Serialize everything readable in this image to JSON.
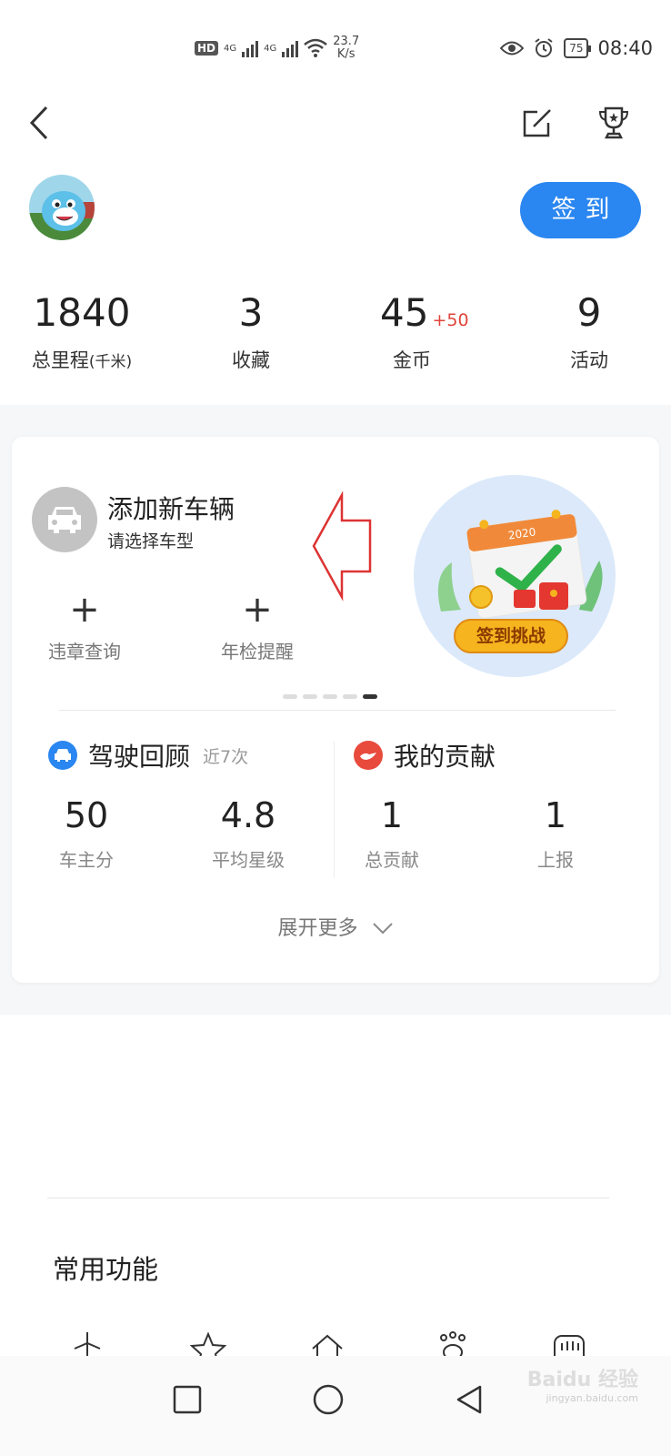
{
  "status_bar": {
    "hd": "HD",
    "net1": "4G",
    "net2": "4G",
    "speed_value": "23.7",
    "speed_unit": "K/s",
    "battery": "75",
    "time": "08:40"
  },
  "header": {
    "icons": [
      "back-icon",
      "edit-icon",
      "trophy-icon"
    ]
  },
  "profile": {
    "signin_label": "签到"
  },
  "stats": [
    {
      "value": "1840",
      "label": "总里程",
      "unit": "(千米)"
    },
    {
      "value": "3",
      "label": "收藏"
    },
    {
      "value": "45",
      "plus": "+50",
      "label": "金币"
    },
    {
      "value": "9",
      "label": "活动"
    }
  ],
  "vehicle": {
    "title": "添加新车辆",
    "subtitle": "请选择车型",
    "quick_actions": [
      {
        "label": "违章查询",
        "icon": "plus-icon"
      },
      {
        "label": "年检提醒",
        "icon": "plus-icon"
      }
    ]
  },
  "promo": {
    "year": "2020",
    "badge": "签到挑战"
  },
  "carousel": {
    "count": 5,
    "active_index": 4
  },
  "driving_review": {
    "title": "驾驶回顾",
    "sub": "近7次",
    "metrics": [
      {
        "value": "50",
        "label": "车主分"
      },
      {
        "value": "4.8",
        "label": "平均星级"
      }
    ]
  },
  "contribution": {
    "title": "我的贡献",
    "metrics": [
      {
        "value": "1",
        "label": "总贡献"
      },
      {
        "value": "1",
        "label": "上报"
      }
    ]
  },
  "expand_label": "展开更多",
  "common": {
    "title": "常用功能"
  },
  "watermark": {
    "brand": "Baidu 经验",
    "url": "jingyan.baidu.com"
  },
  "colors": {
    "accent": "#2a86f0",
    "coin_plus": "#e0443a",
    "contribution_icon": "#e84a3c"
  }
}
